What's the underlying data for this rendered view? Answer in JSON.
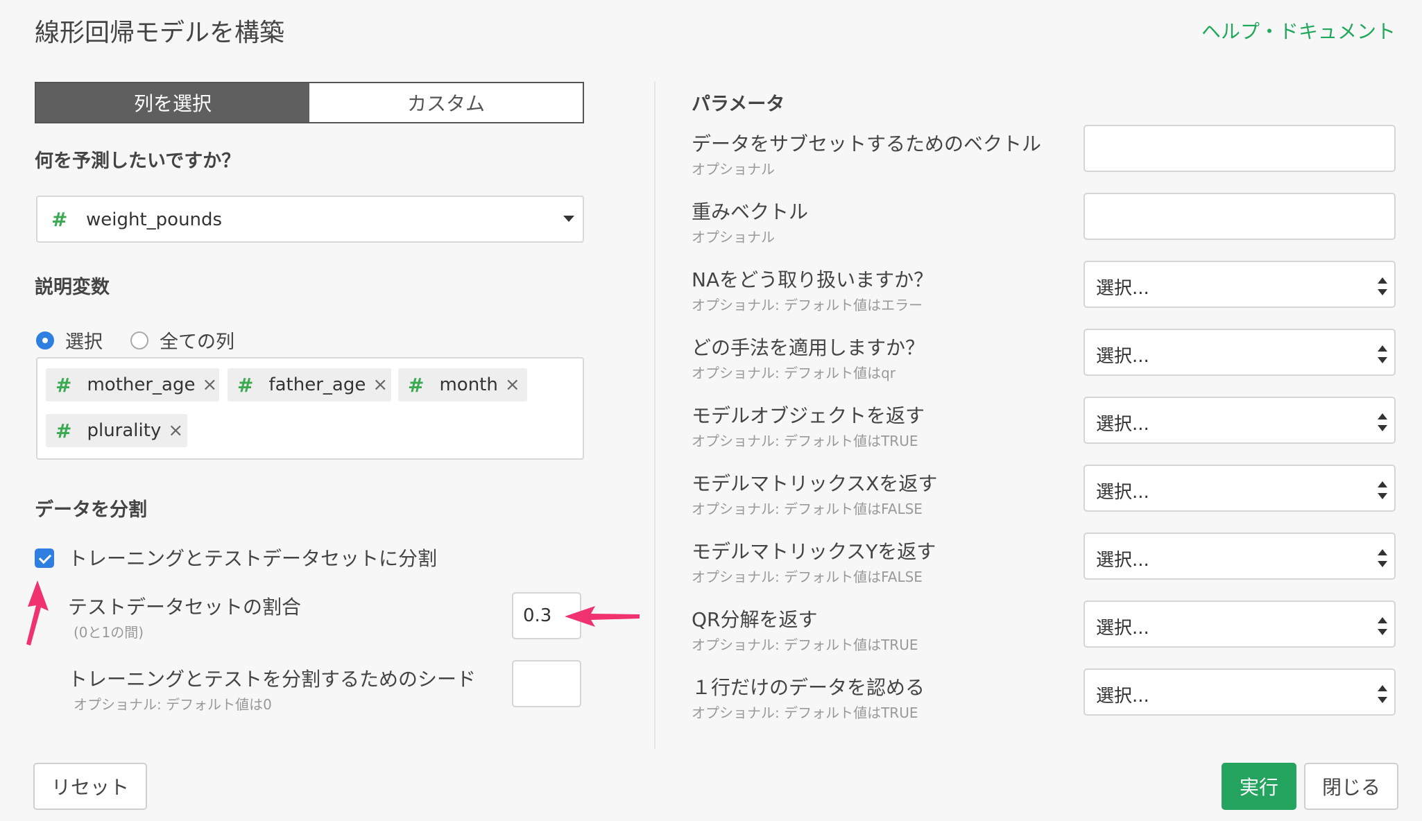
{
  "header": {
    "title": "線形回帰モデルを構築",
    "help_link": "ヘルプ・ドキュメント"
  },
  "tabs": [
    {
      "label": "列を選択",
      "active": true
    },
    {
      "label": "カスタム",
      "active": false
    }
  ],
  "target": {
    "question": "何を予測したいですか？",
    "hash": "#",
    "value": "weight_pounds"
  },
  "explanatory": {
    "title": "説明変数",
    "radio_selected": "選択",
    "radio_all": "全ての列",
    "tags": [
      {
        "hash": "#",
        "label": "mother_age",
        "remove": "×"
      },
      {
        "hash": "#",
        "label": "father_age",
        "remove": "×"
      },
      {
        "hash": "#",
        "label": "month",
        "remove": "×"
      },
      {
        "hash": "#",
        "label": "plurality",
        "remove": "×"
      }
    ]
  },
  "split": {
    "title": "データを分割",
    "checkbox_label": "トレーニングとテストデータセットに分割",
    "checked": true,
    "ratio_label": "テストデータセットの割合",
    "ratio_sub": "(0と1の間)",
    "ratio_value": "0.3",
    "seed_label": "トレーニングとテストを分割するためのシード",
    "seed_sub": "オプショナル: デフォルト値は0",
    "seed_value": ""
  },
  "params": {
    "title": "パラメータ",
    "rows": [
      {
        "label": "データをサブセットするためのベクトル",
        "sub": "オプショナル",
        "value": ""
      },
      {
        "label": "重みベクトル",
        "sub": "オプショナル",
        "value": ""
      },
      {
        "label": "NAをどう取り扱いますか？",
        "sub": "オプショナル: デフォルト値はエラー",
        "value": "選択..."
      },
      {
        "label": "どの手法を適用しますか？",
        "sub": "オプショナル: デフォルト値はqr",
        "value": "選択..."
      },
      {
        "label": "モデルオブジェクトを返す",
        "sub": "オプショナル: デフォルト値はTRUE",
        "value": "選択..."
      },
      {
        "label": "モデルマトリックスXを返す",
        "sub": "オプショナル: デフォルト値はFALSE",
        "value": "選択..."
      },
      {
        "label": "モデルマトリックスYを返す",
        "sub": "オプショナル: デフォルト値はFALSE",
        "value": "選択..."
      },
      {
        "label": "QR分解を返す",
        "sub": "オプショナル: デフォルト値はTRUE",
        "value": "選択..."
      },
      {
        "label": "１行だけのデータを認める",
        "sub": "オプショナル: デフォルト値はTRUE",
        "value": "選択..."
      }
    ]
  },
  "footer": {
    "reset": "リセット",
    "run": "実行",
    "close": "閉じる"
  },
  "colors": {
    "accent_green": "#24a45e",
    "checkbox_blue": "#2f7fe0",
    "annotation_arrow": "#f0336e"
  }
}
